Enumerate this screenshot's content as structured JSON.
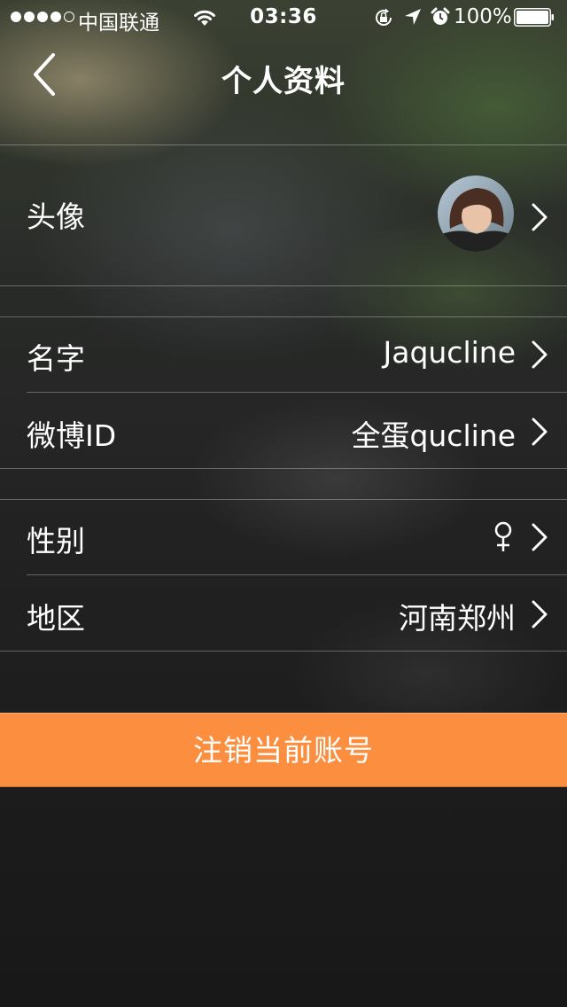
{
  "status_bar": {
    "signal_bars_filled": 4,
    "signal_bars_total": 5,
    "carrier": "中国联通",
    "time": "03:36",
    "battery": "100%"
  },
  "nav": {
    "title": "个人资料",
    "back_icon": "chevron-left-icon"
  },
  "profile": {
    "avatar_label": "头像",
    "name_label": "名字",
    "name_value": "Jaqucline",
    "weibo_label": "微博ID",
    "weibo_value": "全蛋qucline",
    "gender_label": "性别",
    "gender_icon": "female-symbol-icon",
    "region_label": "地区",
    "region_value": "河南郑州"
  },
  "actions": {
    "logout_label": "注销当前账号"
  },
  "colors": {
    "accent": "#fb8f3f"
  }
}
